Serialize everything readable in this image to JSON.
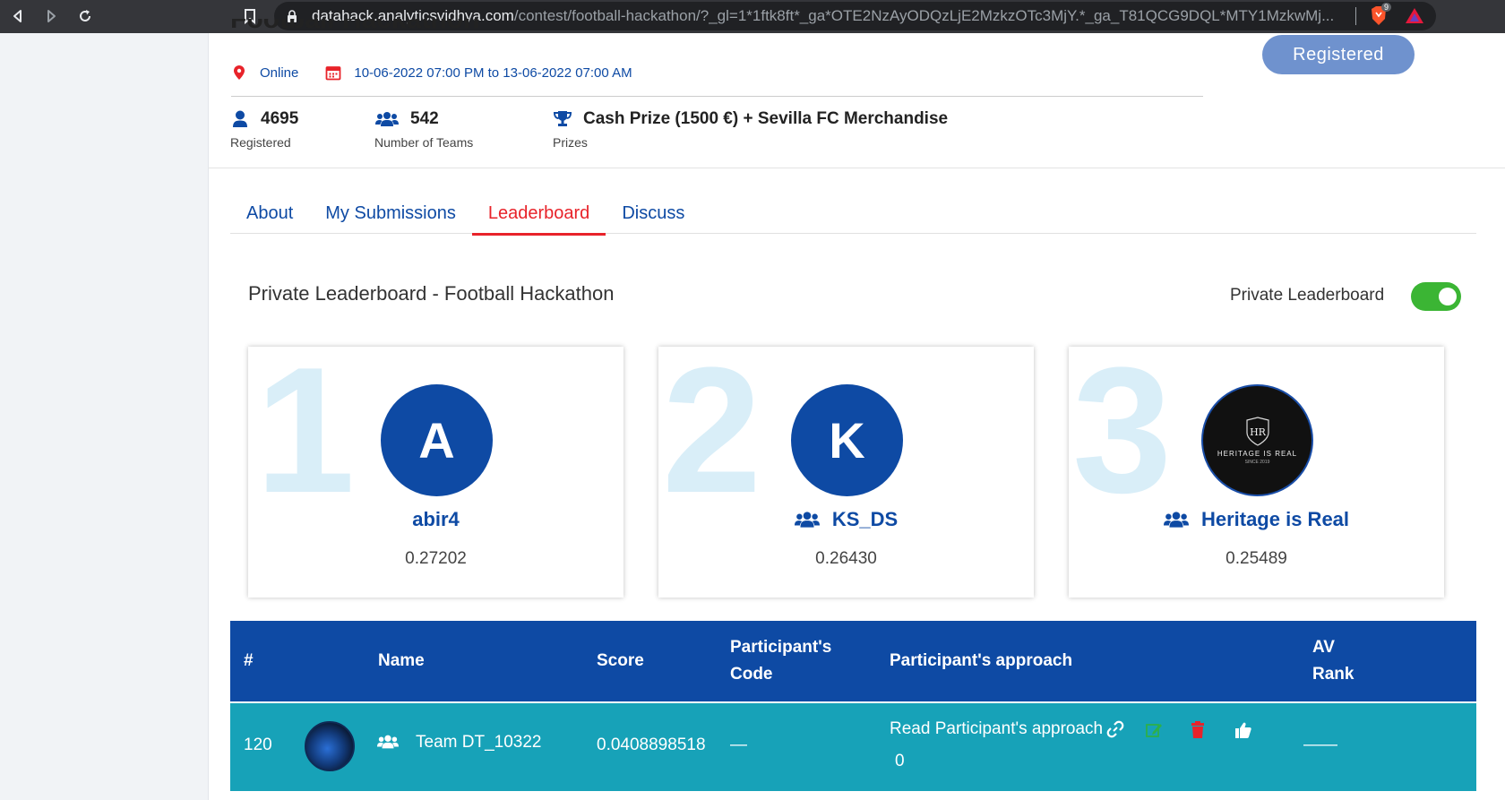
{
  "browser": {
    "url_host": "datahack.analyticsvidhya.com",
    "url_path": "/contest/football-hackathon/?_gl=1*1ftk8ft*_ga*OTE2NzAyODQzLjE2MzkzOTc3MjY.*_ga_T81QCG9DQL*MTY1MzkwMj...",
    "brave_badge": "9"
  },
  "contest": {
    "title": "Football Hackathon",
    "location": "Online",
    "dates": "10-06-2022 07:00 PM to 13-06-2022 07:00 AM",
    "register_button": "Registered",
    "stats": [
      {
        "value": "4695",
        "label": "Registered",
        "icon": "user-icon"
      },
      {
        "value": "542",
        "label": "Number of Teams",
        "icon": "users-icon"
      },
      {
        "value": "Cash Prize (1500 €) + Sevilla FC Merchandise",
        "label": "Prizes",
        "icon": "trophy-icon"
      }
    ]
  },
  "tabs": [
    {
      "label": "About",
      "active": false
    },
    {
      "label": "My Submissions",
      "active": false
    },
    {
      "label": "Leaderboard",
      "active": true
    },
    {
      "label": "Discuss",
      "active": false
    }
  ],
  "leaderboard": {
    "title": "Private Leaderboard - Football Hackathon",
    "toggle_label": "Private Leaderboard",
    "toggle_on": true,
    "podium": [
      {
        "rank": "1",
        "initial": "A",
        "name": "abir4",
        "score": "0.27202",
        "team": false
      },
      {
        "rank": "2",
        "initial": "K",
        "name": "KS_DS",
        "score": "0.26430",
        "team": true
      },
      {
        "rank": "3",
        "initial": "HR",
        "logo_text": "HERITAGE IS REAL",
        "logo_sub": "SINCE 2019",
        "name": "Heritage is Real",
        "score": "0.25489",
        "team": true
      }
    ],
    "columns": [
      "#",
      "Name",
      "Score",
      "Participant's Code",
      "Participant's approach",
      "AV Rank"
    ],
    "row": {
      "rank": "120",
      "name": "Team DT_10322",
      "score": "0.0408898518",
      "code": "—",
      "approach_link": "Read Participant's approach",
      "likes": "0",
      "av_rank": "——"
    }
  },
  "colors": {
    "primary": "#0e4aa4",
    "active_tab": "#e8232a",
    "row_bg": "#17a2b8",
    "toggle_on": "#3bb534",
    "register_btn": "#6f92ce"
  }
}
